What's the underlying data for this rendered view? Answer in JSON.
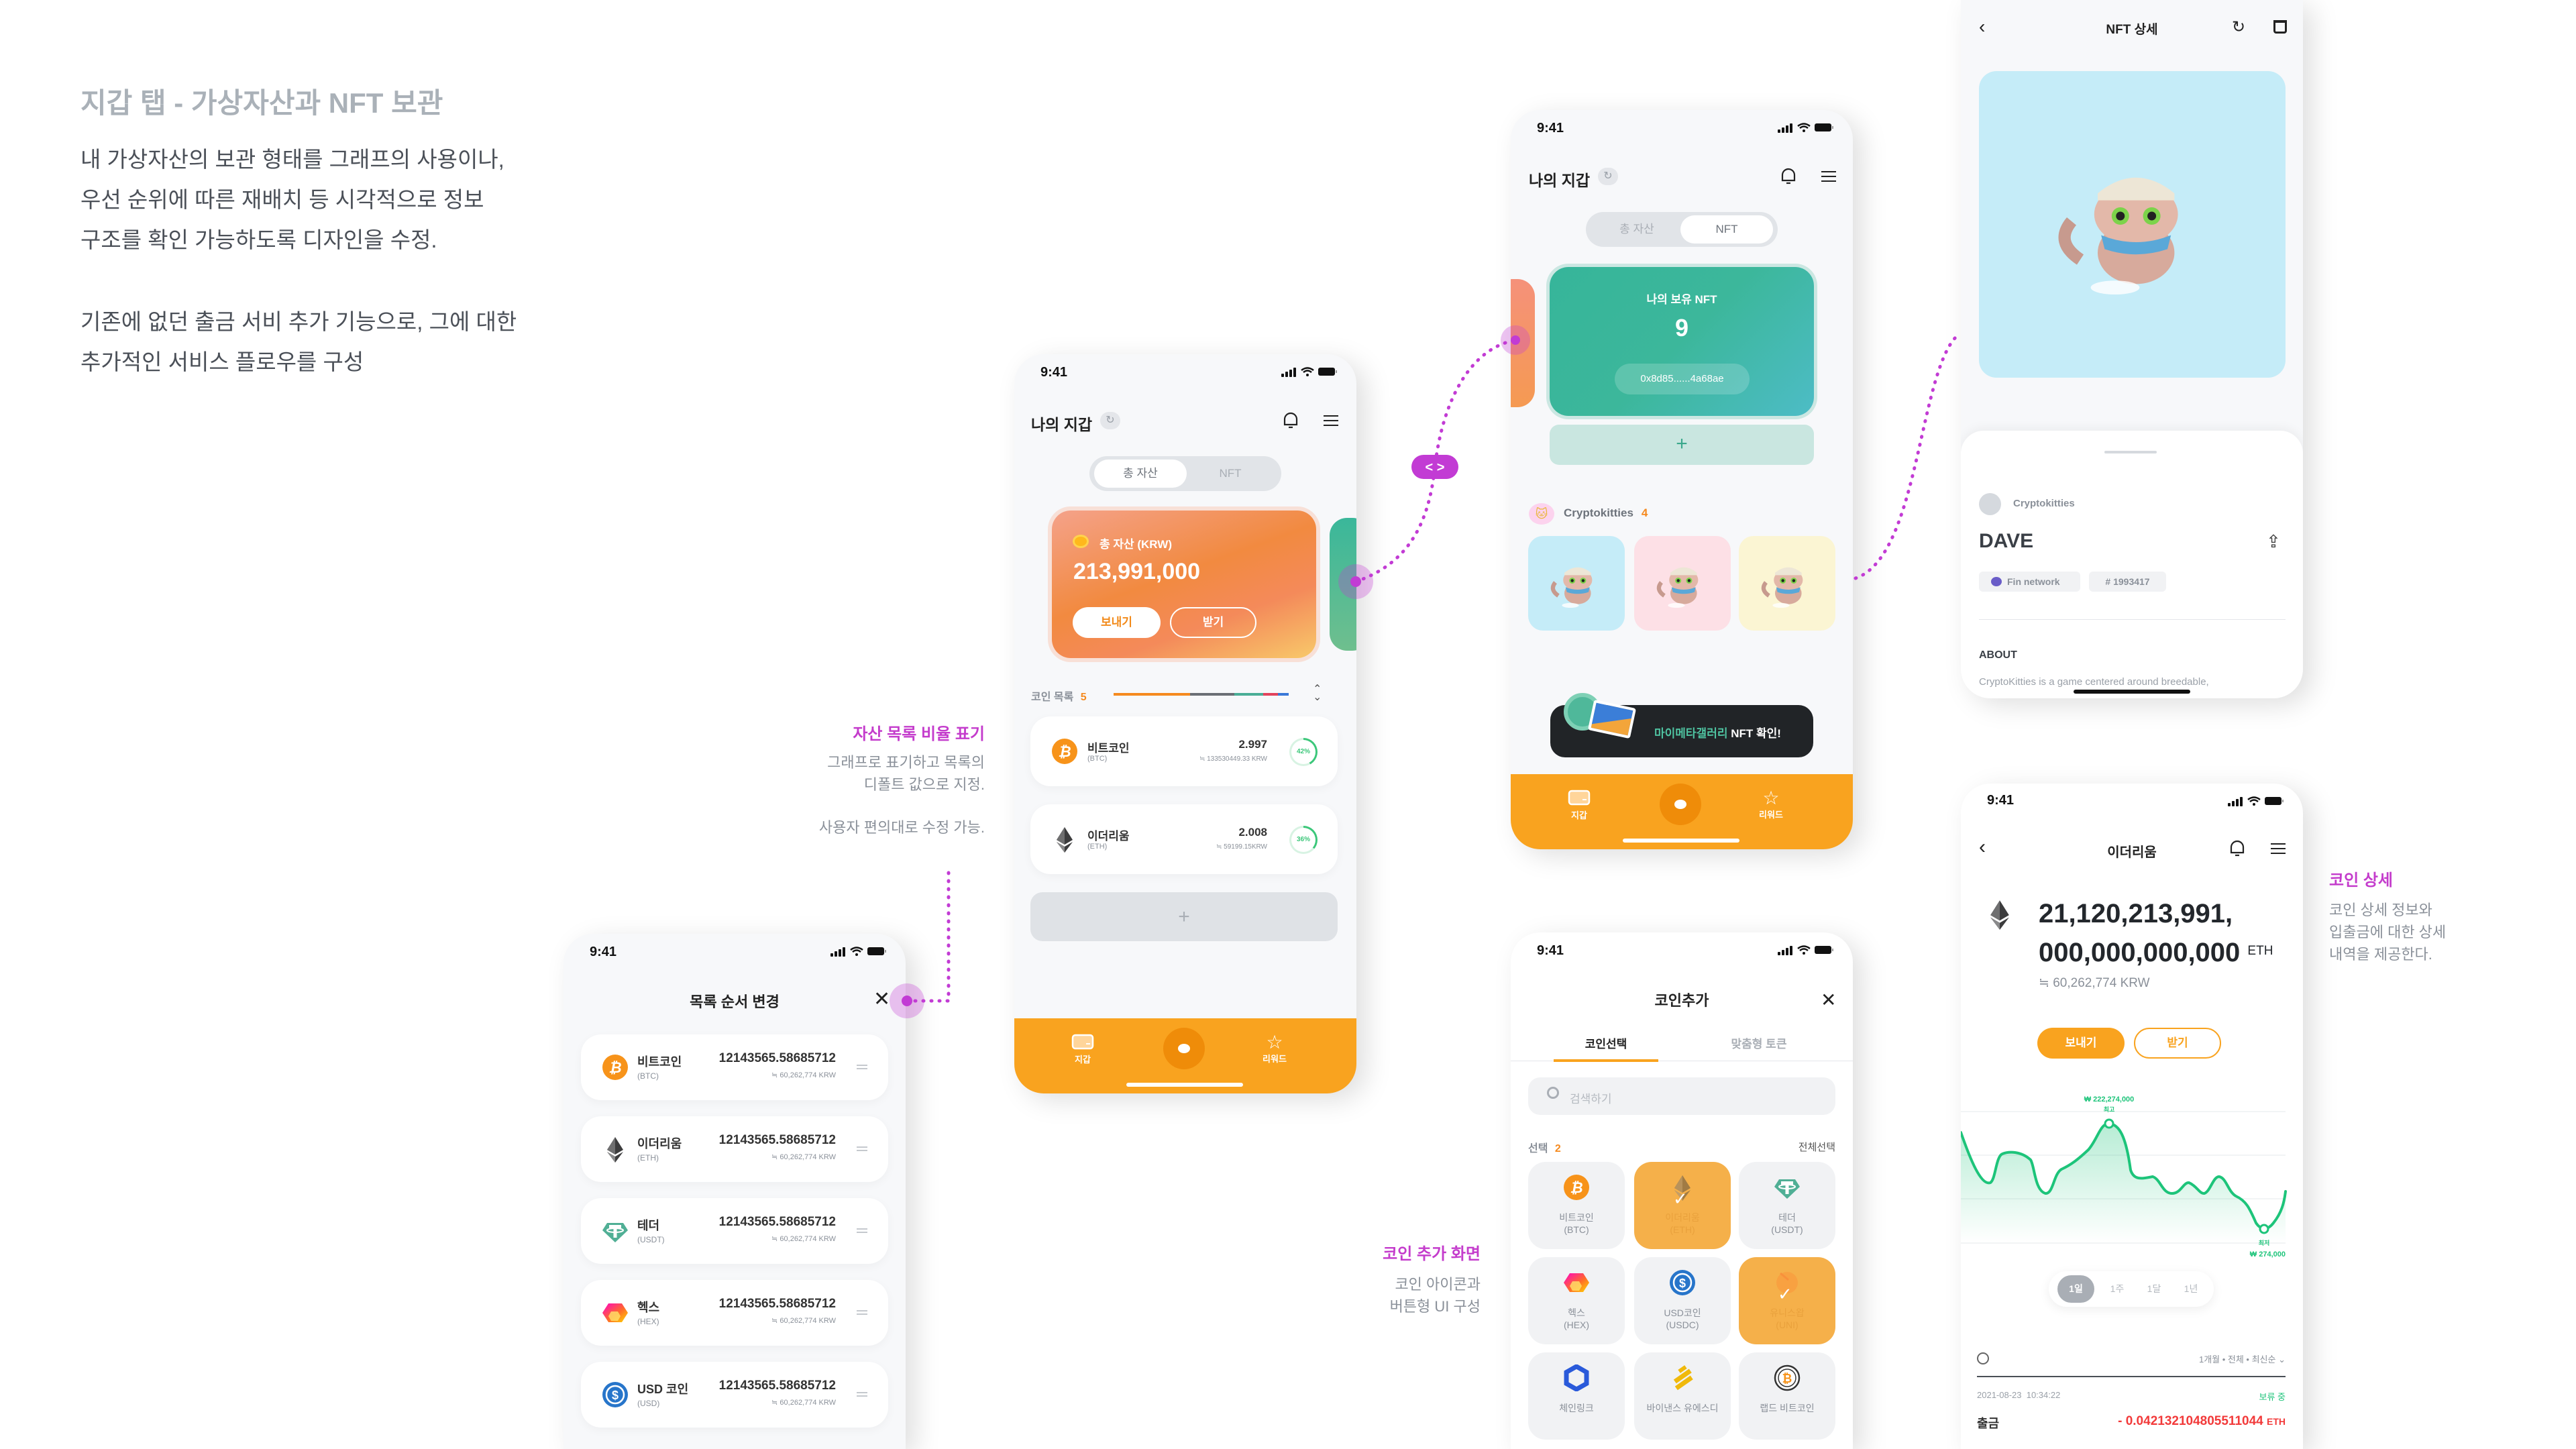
{
  "intro": {
    "title": "지갑 탭 - 가상자산과 NFT 보관",
    "para1": [
      "내 가상자산의 보관 형태를 그래프의 사용이나,",
      "우선 순위에 따른 재배치 등 시각적으로 정보",
      "구조를 확인 가능하도록 디자인을 수정."
    ],
    "para2": [
      "기존에 없던 출금 서비 추가 기능으로, 그에  대한",
      "추가적인 서비스 플로우를 구성"
    ]
  },
  "annotations": {
    "ratio": {
      "title": "자산 목록 비율 표기",
      "lines": [
        "그래프로 표기하고 목록의",
        "디폴트 값으로 지정.",
        "사용자 편의대로 수정 가능."
      ]
    },
    "coin_add": {
      "title": "코인 추가 화면",
      "lines": [
        "코인 아이콘과",
        "버튼형 UI 구성"
      ]
    },
    "coin_detail": {
      "title": "코인 상세",
      "lines": [
        "코인 상세 정보와",
        "입출금에 대한 상세",
        "내역을 제공한다."
      ]
    },
    "toggle_badge": "< >"
  },
  "status": {
    "time": "9:41"
  },
  "colors": {
    "accent": "#f9a31f",
    "annotation": "#c43ccc",
    "positive": "#1dc47a",
    "negative": "#f23a3a"
  },
  "reorder": {
    "title": "목록 순서 변경",
    "rows": [
      {
        "icon": "btc",
        "name": "비트코인",
        "ticker": "(BTC)",
        "amount": "12143565.58685712",
        "krw": "≒ 60,262,774 KRW"
      },
      {
        "icon": "eth",
        "name": "이더리움",
        "ticker": "(ETH)",
        "amount": "12143565.58685712",
        "krw": "≒ 60,262,774 KRW"
      },
      {
        "icon": "usdt",
        "name": "테더",
        "ticker": "(USDT)",
        "amount": "12143565.58685712",
        "krw": "≒ 60,262,774 KRW"
      },
      {
        "icon": "hex",
        "name": "헥스",
        "ticker": "(HEX)",
        "amount": "12143565.58685712",
        "krw": "≒ 60,262,774 KRW"
      },
      {
        "icon": "usdc",
        "name": "USD 코인",
        "ticker": "(USD)",
        "amount": "12143565.58685712",
        "krw": "≒ 60,262,774 KRW"
      }
    ]
  },
  "wallet": {
    "title": "나의 지갑",
    "seg": [
      "총 자산",
      "NFT"
    ],
    "card_label": "총 자산 (KRW)",
    "total": "213,991,000",
    "send": "보내기",
    "receive": "받기",
    "list_label": "코인 목록",
    "list_count": "5",
    "ratio_pct": [
      43.5,
      25.5,
      16.5,
      8.5,
      6
    ],
    "ratio_colors": [
      "#f58a1f",
      "#6b6f75",
      "#4aae96",
      "#e2445c",
      "#3a78d8"
    ],
    "coins": [
      {
        "icon": "btc",
        "name": "비트코인",
        "ticker": "(BTC)",
        "amount": "2.997",
        "krw": "≒ 133530449.33 KRW",
        "pct": "42%",
        "pct_value": 42
      },
      {
        "icon": "eth",
        "name": "이더리움",
        "ticker": "(ETH)",
        "amount": "2.008",
        "krw": "≒ 59199.15KRW",
        "pct": "36%",
        "pct_value": 36
      }
    ],
    "add": "+",
    "tabs": [
      "지갑",
      "리워드"
    ]
  },
  "nft": {
    "title": "나의 지갑",
    "seg": [
      "총 자산",
      "NFT"
    ],
    "card_label": "나의 보유 NFT",
    "count": "9",
    "address": "0x8d85......4a68ae",
    "add": "+",
    "collection": "Cryptokitties",
    "collection_count": "4",
    "banner_highlight": "마이메타갤러리",
    "banner_rest": " NFT 확인!",
    "tabs": [
      "지갑",
      "리워드"
    ]
  },
  "nft_detail": {
    "title": "NFT 상세",
    "collection": "Cryptokitties",
    "name": "DAVE",
    "network": "Fin network",
    "token_id": "# 1993417",
    "about": "ABOUT",
    "description": "CryptoKitties is a game centered around breedable,"
  },
  "coin_add": {
    "title": "코인추가",
    "tabs": [
      "코인선택",
      "맞춤형 토큰"
    ],
    "search_placeholder": "검색하기",
    "selected_label": "선택",
    "selected_count": "2",
    "select_all": "전체선택",
    "tiles": [
      {
        "icon": "btc",
        "name": "비트코인",
        "ticker": "(BTC)",
        "selected": false
      },
      {
        "icon": "eth",
        "name": "이더리움",
        "ticker": "(ETH)",
        "selected": true
      },
      {
        "icon": "usdt",
        "name": "테더",
        "ticker": "(USDT)",
        "selected": false
      },
      {
        "icon": "hex",
        "name": "헥스",
        "ticker": "(HEX)",
        "selected": false
      },
      {
        "icon": "usdc",
        "name": "USD코인",
        "ticker": "(USDC)",
        "selected": false
      },
      {
        "icon": "uni",
        "name": "유니스왑",
        "ticker": "(UNI)",
        "selected": true
      },
      {
        "icon": "link",
        "name": "체인링크",
        "ticker": "",
        "selected": false
      },
      {
        "icon": "busd",
        "name": "바이낸스 유에스디",
        "ticker": "",
        "selected": false
      },
      {
        "icon": "wbtc",
        "name": "랩드 비트코인",
        "ticker": "",
        "selected": false
      }
    ]
  },
  "coin_detail": {
    "title": "이더리움",
    "amount_line1": "21,120,213,991,",
    "amount_line2": "000,000,000,000",
    "unit": "ETH",
    "krw": "≒ 60,262,774 KRW",
    "send": "보내기",
    "receive": "받기",
    "high_value": "₩ 222,274,000",
    "high_label": "최고",
    "low_label": "최저",
    "low_value": "₩ 274,000",
    "periods": [
      "1일",
      "1주",
      "1달",
      "1년"
    ],
    "active_period": 0,
    "filter": "1개월 • 전체 • 최신순",
    "tx": {
      "date": "2021-08-23  10:34:22",
      "status": "보류 중",
      "type": "출금",
      "amount": "- 0.042132104805511044",
      "unit": "ETH"
    }
  }
}
